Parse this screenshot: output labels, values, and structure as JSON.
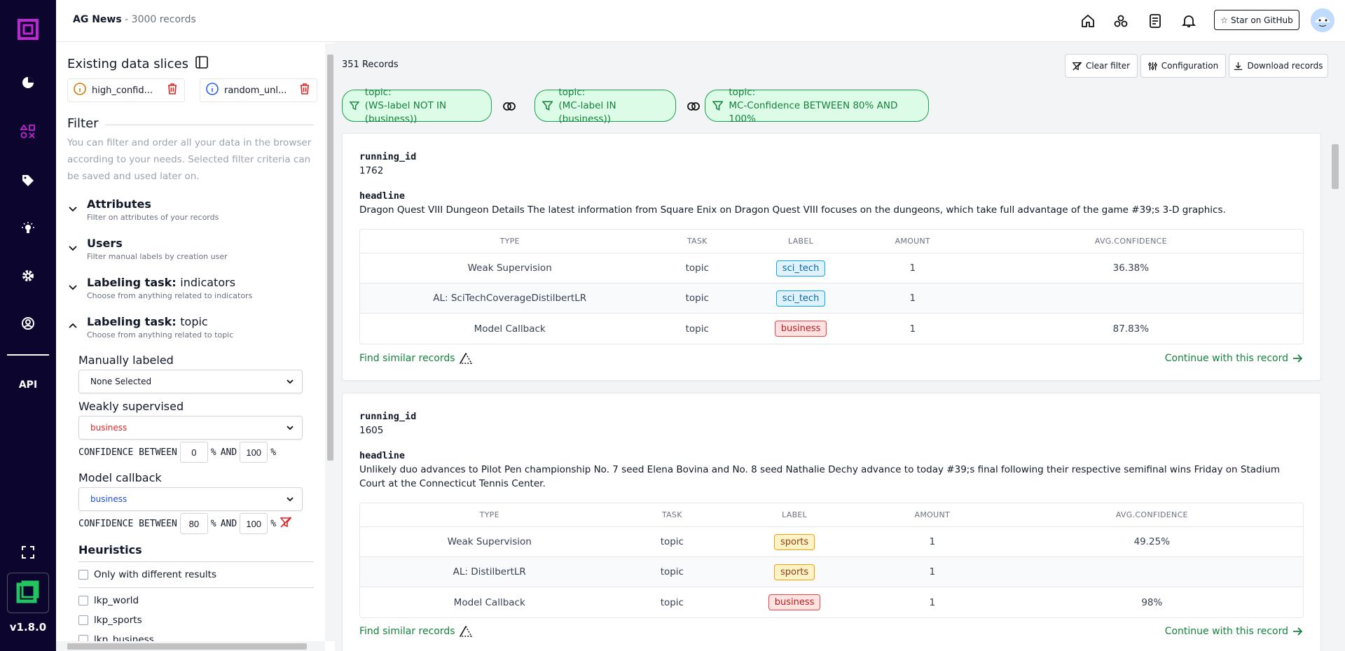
{
  "rail": {
    "api_label": "API",
    "version": "v1.8.0"
  },
  "topbar": {
    "project_name": "AG News",
    "record_count": "3000 records",
    "github_label": "Star on GitHub"
  },
  "sidebar": {
    "slices_title": "Existing data slices",
    "slices": [
      {
        "name": "high_confid..."
      },
      {
        "name": "random_unl..."
      }
    ],
    "filter_title": "Filter",
    "filter_desc": "You can filter and order all your data in the browser according to your needs. Selected filter criteria can be saved and used later on.",
    "groups": [
      {
        "title": "Attributes",
        "sub": "",
        "desc": "Filter on attributes of your records"
      },
      {
        "title": "Users",
        "sub": "",
        "desc": "Filter manual labels by creation user"
      },
      {
        "title": "Labeling task:",
        "sub": "indicators",
        "desc": "Choose from anything related to indicators"
      },
      {
        "title": "Labeling task:",
        "sub": "topic",
        "desc": "Choose from anything related to topic"
      }
    ],
    "manual_label": "Manually labeled",
    "manual_value": "None Selected",
    "weak_label": "Weakly supervised",
    "weak_value": "business",
    "conf_text": "CONFIDENCE BETWEEN",
    "pct": "%",
    "and": "AND",
    "weak_min": "0",
    "weak_max": "100",
    "model_label": "Model callback",
    "model_value": "business",
    "model_min": "80",
    "model_max": "100",
    "heur_title": "Heuristics",
    "heur_only_diff": "Only with different results",
    "heuristics": [
      "lkp_world",
      "lkp_sports",
      "lkp_business"
    ]
  },
  "main": {
    "count": "351 Records",
    "buttons": {
      "clear": "Clear filter",
      "config": "Configuration",
      "download": "Download records"
    },
    "pills": [
      {
        "l1": "topic:",
        "l2": "(WS-label NOT IN (business))"
      },
      {
        "l1": "topic:",
        "l2": "(MC-label IN (business))"
      },
      {
        "l1": "topic:",
        "l2": "MC-Confidence BETWEEN 80% AND 100%"
      }
    ],
    "table_headers": {
      "type": "TYPE",
      "task": "TASK",
      "label": "LABEL",
      "amount": "AMOUNT",
      "conf": "AVG.CONFIDENCE"
    },
    "find_similar": "Find similar records",
    "continue": "Continue with this record",
    "records": [
      {
        "id_label": "running_id",
        "id": "1762",
        "headline_label": "headline",
        "headline": "Dragon Quest VIII Dungeon Details The latest information from Square Enix on Dragon Quest VIII focuses on the dungeons, which take full advantage of the game #39;s 3-D graphics.",
        "rows": [
          {
            "type": "Weak Supervision",
            "task": "topic",
            "label": "sci_tech",
            "amount": "1",
            "conf": "36.38%"
          },
          {
            "type": "AL: SciTechCoverageDistilbertLR",
            "task": "topic",
            "label": "sci_tech",
            "amount": "1",
            "conf": ""
          },
          {
            "type": "Model Callback",
            "task": "topic",
            "label": "business",
            "amount": "1",
            "conf": "87.83%"
          }
        ]
      },
      {
        "id_label": "running_id",
        "id": "1605",
        "headline_label": "headline",
        "headline": "Unlikely duo advances to Pilot Pen championship No. 7 seed Elena Bovina and No. 8 seed Nathalie Dechy advance to today #39;s final following their respective semifinal wins Friday on Stadium Court at the Connecticut Tennis Center.",
        "rows": [
          {
            "type": "Weak Supervision",
            "task": "topic",
            "label": "sports",
            "amount": "1",
            "conf": "49.25%"
          },
          {
            "type": "AL: DistilbertLR",
            "task": "topic",
            "label": "sports",
            "amount": "1",
            "conf": ""
          },
          {
            "type": "Model Callback",
            "task": "topic",
            "label": "business",
            "amount": "1",
            "conf": "98%"
          }
        ]
      }
    ]
  }
}
